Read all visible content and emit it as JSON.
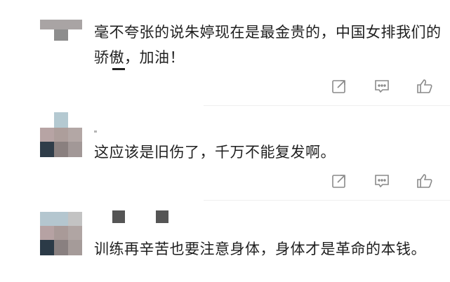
{
  "comments": [
    {
      "text": "毫不夸张的说朱婷现在是最金贵的，中国女排我们的骄傲，加油！"
    },
    {
      "text": "这应该是旧伤了，千万不能复发啊。"
    },
    {
      "text": "训练再辛苦也要注意身体，身体才是革命的本钱。"
    }
  ],
  "icons": {
    "share": "share-icon",
    "comment": "comment-icon",
    "like": "thumbs-up-icon"
  },
  "colors": {
    "icon": "#8a8a8a",
    "text": "#1f1f1f",
    "divider": "#efefef"
  }
}
